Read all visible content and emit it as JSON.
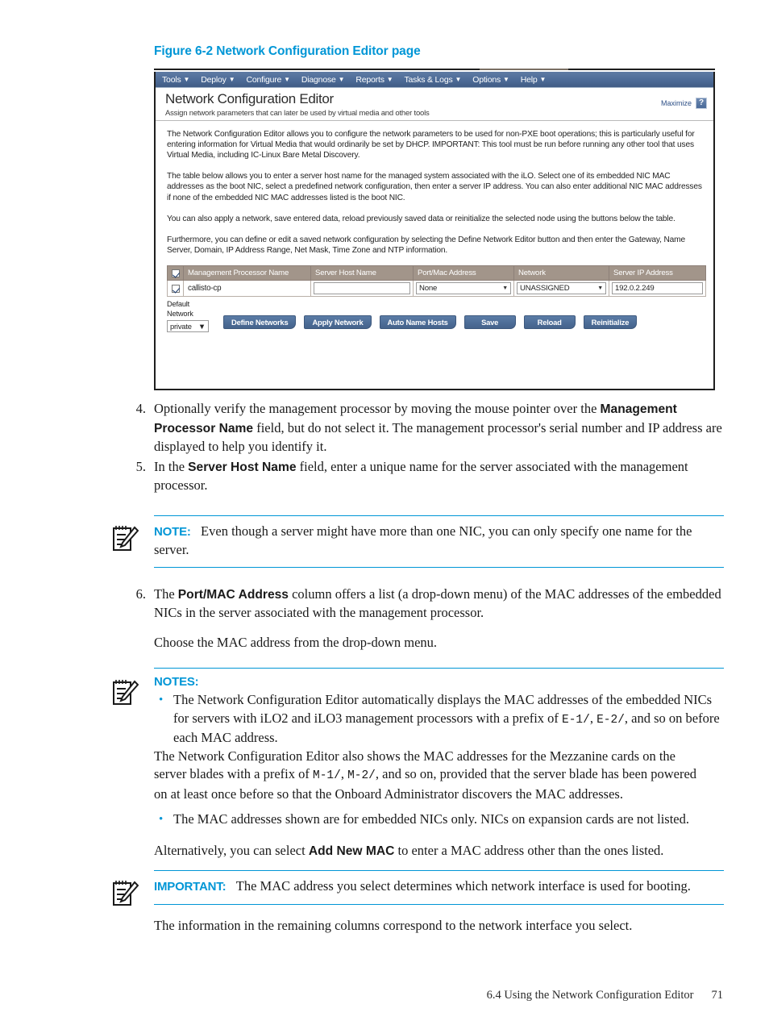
{
  "figure": {
    "caption": "Figure 6-2 Network Configuration Editor page",
    "app": {
      "menu": [
        {
          "label": "Tools"
        },
        {
          "label": "Deploy"
        },
        {
          "label": "Configure"
        },
        {
          "label": "Diagnose"
        },
        {
          "label": "Reports"
        },
        {
          "label": "Tasks & Logs"
        },
        {
          "label": "Options"
        },
        {
          "label": "Help"
        }
      ],
      "title": "Network Configuration Editor",
      "subtitle": "Assign network parameters that can later be used by virtual media and other tools",
      "maximize_label": "Maximize",
      "help_label": "?",
      "paragraphs": [
        "The Network Configuration Editor allows you to configure the network parameters to be used for non-PXE boot operations; this is particularly useful for entering information for Virtual Media that would ordinarily be set by DHCP. IMPORTANT: This tool must be run before running any other tool that uses Virtual Media, including IC-Linux Bare Metal Discovery.",
        "The table below allows you to enter a server host name for the managed system associated with the iLO. Select one of its embedded NIC MAC addresses as the boot NIC, select a predefined network configuration, then enter a server IP address. You can also enter additional NIC MAC addresses if none of the embedded NIC MAC addresses listed is the boot NIC.",
        "You can also apply a network, save entered data, reload previously saved data or reinitialize the selected node using the buttons below the table.",
        "Furthermore, you can define or edit a saved network configuration by selecting the Define Network Editor button and then enter the Gateway, Name Server, Domain, IP Address Range, Net Mask, Time Zone and NTP information."
      ],
      "table": {
        "headers": [
          "Management Processor Name",
          "Server Host Name",
          "Port/Mac Address",
          "Network",
          "Server IP Address"
        ],
        "row": {
          "selected": true,
          "management_processor_name": "callisto-cp",
          "server_host_name": "",
          "port_mac_address": "None",
          "network": "UNASSIGNED",
          "server_ip_address": "192.0.2.249"
        }
      },
      "default_network": {
        "label_line1": "Default",
        "label_line2": "Network",
        "value": "private"
      },
      "buttons": [
        "Define Networks",
        "Apply Network",
        "Auto Name Hosts",
        "Save",
        "Reload",
        "Reinitialize"
      ]
    }
  },
  "doc": {
    "steps": [
      {
        "num": "4.",
        "parts": [
          {
            "t": "Optionally verify the management processor by moving the mouse pointer over the "
          },
          {
            "t": "Management Processor Name",
            "b": true
          },
          {
            "t": " field, but do not select it. The management processor's serial number and IP address are displayed to help you identify it."
          }
        ]
      },
      {
        "num": "5.",
        "parts": [
          {
            "t": "In the "
          },
          {
            "t": "Server Host Name",
            "b": true
          },
          {
            "t": " field, enter a unique name for the server associated with the management processor."
          }
        ]
      }
    ],
    "note1": {
      "icon": "note-pencil-icon",
      "label": "NOTE:",
      "text": "Even though a server might have more than one NIC, you can only specify one name for the server."
    },
    "step6": {
      "num": "6.",
      "parts": [
        {
          "t": "The "
        },
        {
          "t": "Port/MAC Address",
          "b": true
        },
        {
          "t": " column offers a list (a drop-down menu) of the MAC addresses of the embedded NICs in the server associated with the management processor."
        }
      ]
    },
    "choose_para": "Choose the MAC address from the drop-down menu.",
    "notes": {
      "icon": "note-pencil-icon",
      "label": "NOTES:",
      "bullets": [
        {
          "parts": [
            {
              "t": "The Network Configuration Editor automatically displays the MAC addresses of the embedded NICs for servers with iLO2 and iLO3 management processors with a prefix of "
            },
            {
              "t": "E-1/",
              "m": true
            },
            {
              "t": ", "
            },
            {
              "t": "E-2/",
              "m": true
            },
            {
              "t": ", and so on before each MAC address."
            }
          ]
        },
        {
          "parts": [
            {
              "t": "The MAC addresses shown are for embedded NICs only. NICs on expansion cards are not listed."
            }
          ]
        }
      ],
      "sub_paragraph": {
        "parts": [
          {
            "t": "The Network Configuration Editor also shows the MAC addresses for the Mezzanine cards on the server blades with a prefix of "
          },
          {
            "t": "M-1/",
            "m": true
          },
          {
            "t": ", "
          },
          {
            "t": "M-2/",
            "m": true
          },
          {
            "t": ", and so on, provided that the server blade has been powered on at least once before so that the Onboard Administrator discovers the MAC addresses."
          }
        ]
      }
    },
    "alternatively": {
      "parts": [
        {
          "t": "Alternatively, you can select "
        },
        {
          "t": "Add New MAC",
          "b": true
        },
        {
          "t": " to enter a MAC address other than the ones listed."
        }
      ]
    },
    "important": {
      "icon": "note-pencil-icon",
      "label": "IMPORTANT:",
      "text": "The MAC address you select determines which network interface is used for booting."
    },
    "closing_para": "The information in the remaining columns correspond to the network interface you select.",
    "footer": {
      "section": "6.4 Using the Network Configuration Editor",
      "page": "71"
    }
  },
  "colors": {
    "accent": "#0096d6",
    "menubar": "#4e6f99",
    "table_header": "#a2958a",
    "button": "#4e6f99"
  }
}
